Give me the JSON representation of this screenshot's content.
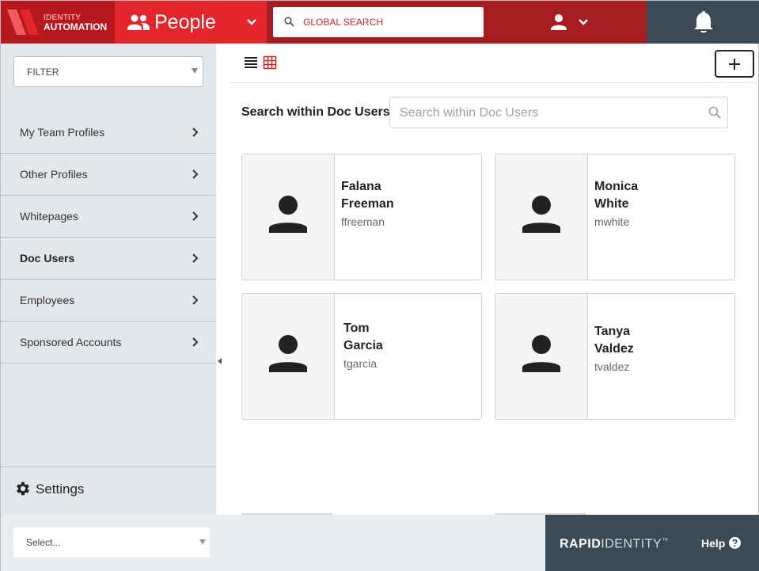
{
  "header": {
    "brand_line1": "IDENTITY",
    "brand_line2": "AUTOMATION",
    "module_label": "People",
    "global_search_placeholder": "GLOBAL SEARCH"
  },
  "sidebar": {
    "filter_label": "FILTER",
    "items": [
      {
        "label": "My Team Profiles"
      },
      {
        "label": "Other Profiles"
      },
      {
        "label": "Whitepages"
      },
      {
        "label": "Doc Users",
        "active": true
      },
      {
        "label": "Employees"
      },
      {
        "label": "Sponsored Accounts"
      }
    ],
    "settings_label": "Settings"
  },
  "main": {
    "search_label": "Search within Doc Users:",
    "search_placeholder": "Search within Doc Users",
    "cards": [
      {
        "first": "Falana",
        "last": "Freeman",
        "username": "ffreeman"
      },
      {
        "first": "Monica",
        "last": "White",
        "username": "mwhite"
      },
      {
        "first": "Tom",
        "last": "Garcia",
        "username": "tgarcia"
      },
      {
        "first": "Tanya",
        "last": "Valdez",
        "username": "tvaldez"
      }
    ]
  },
  "footer": {
    "select_placeholder": "Select...",
    "logo_bold": "RAPID",
    "logo_light": "IDENTITY",
    "logo_tm": "™",
    "help_label": "Help"
  },
  "colors": {
    "brand_red": "#e3262b",
    "header_dark_red": "#a51d22",
    "slate": "#3b4a54",
    "sidebar_bg": "#e4e7ea"
  },
  "icons": [
    "people-icon",
    "search-icon",
    "user-icon",
    "bell-icon",
    "chevron-right-icon",
    "gear-icon",
    "list-view-icon",
    "grid-view-icon",
    "plus-icon",
    "avatar-icon",
    "help-icon"
  ]
}
